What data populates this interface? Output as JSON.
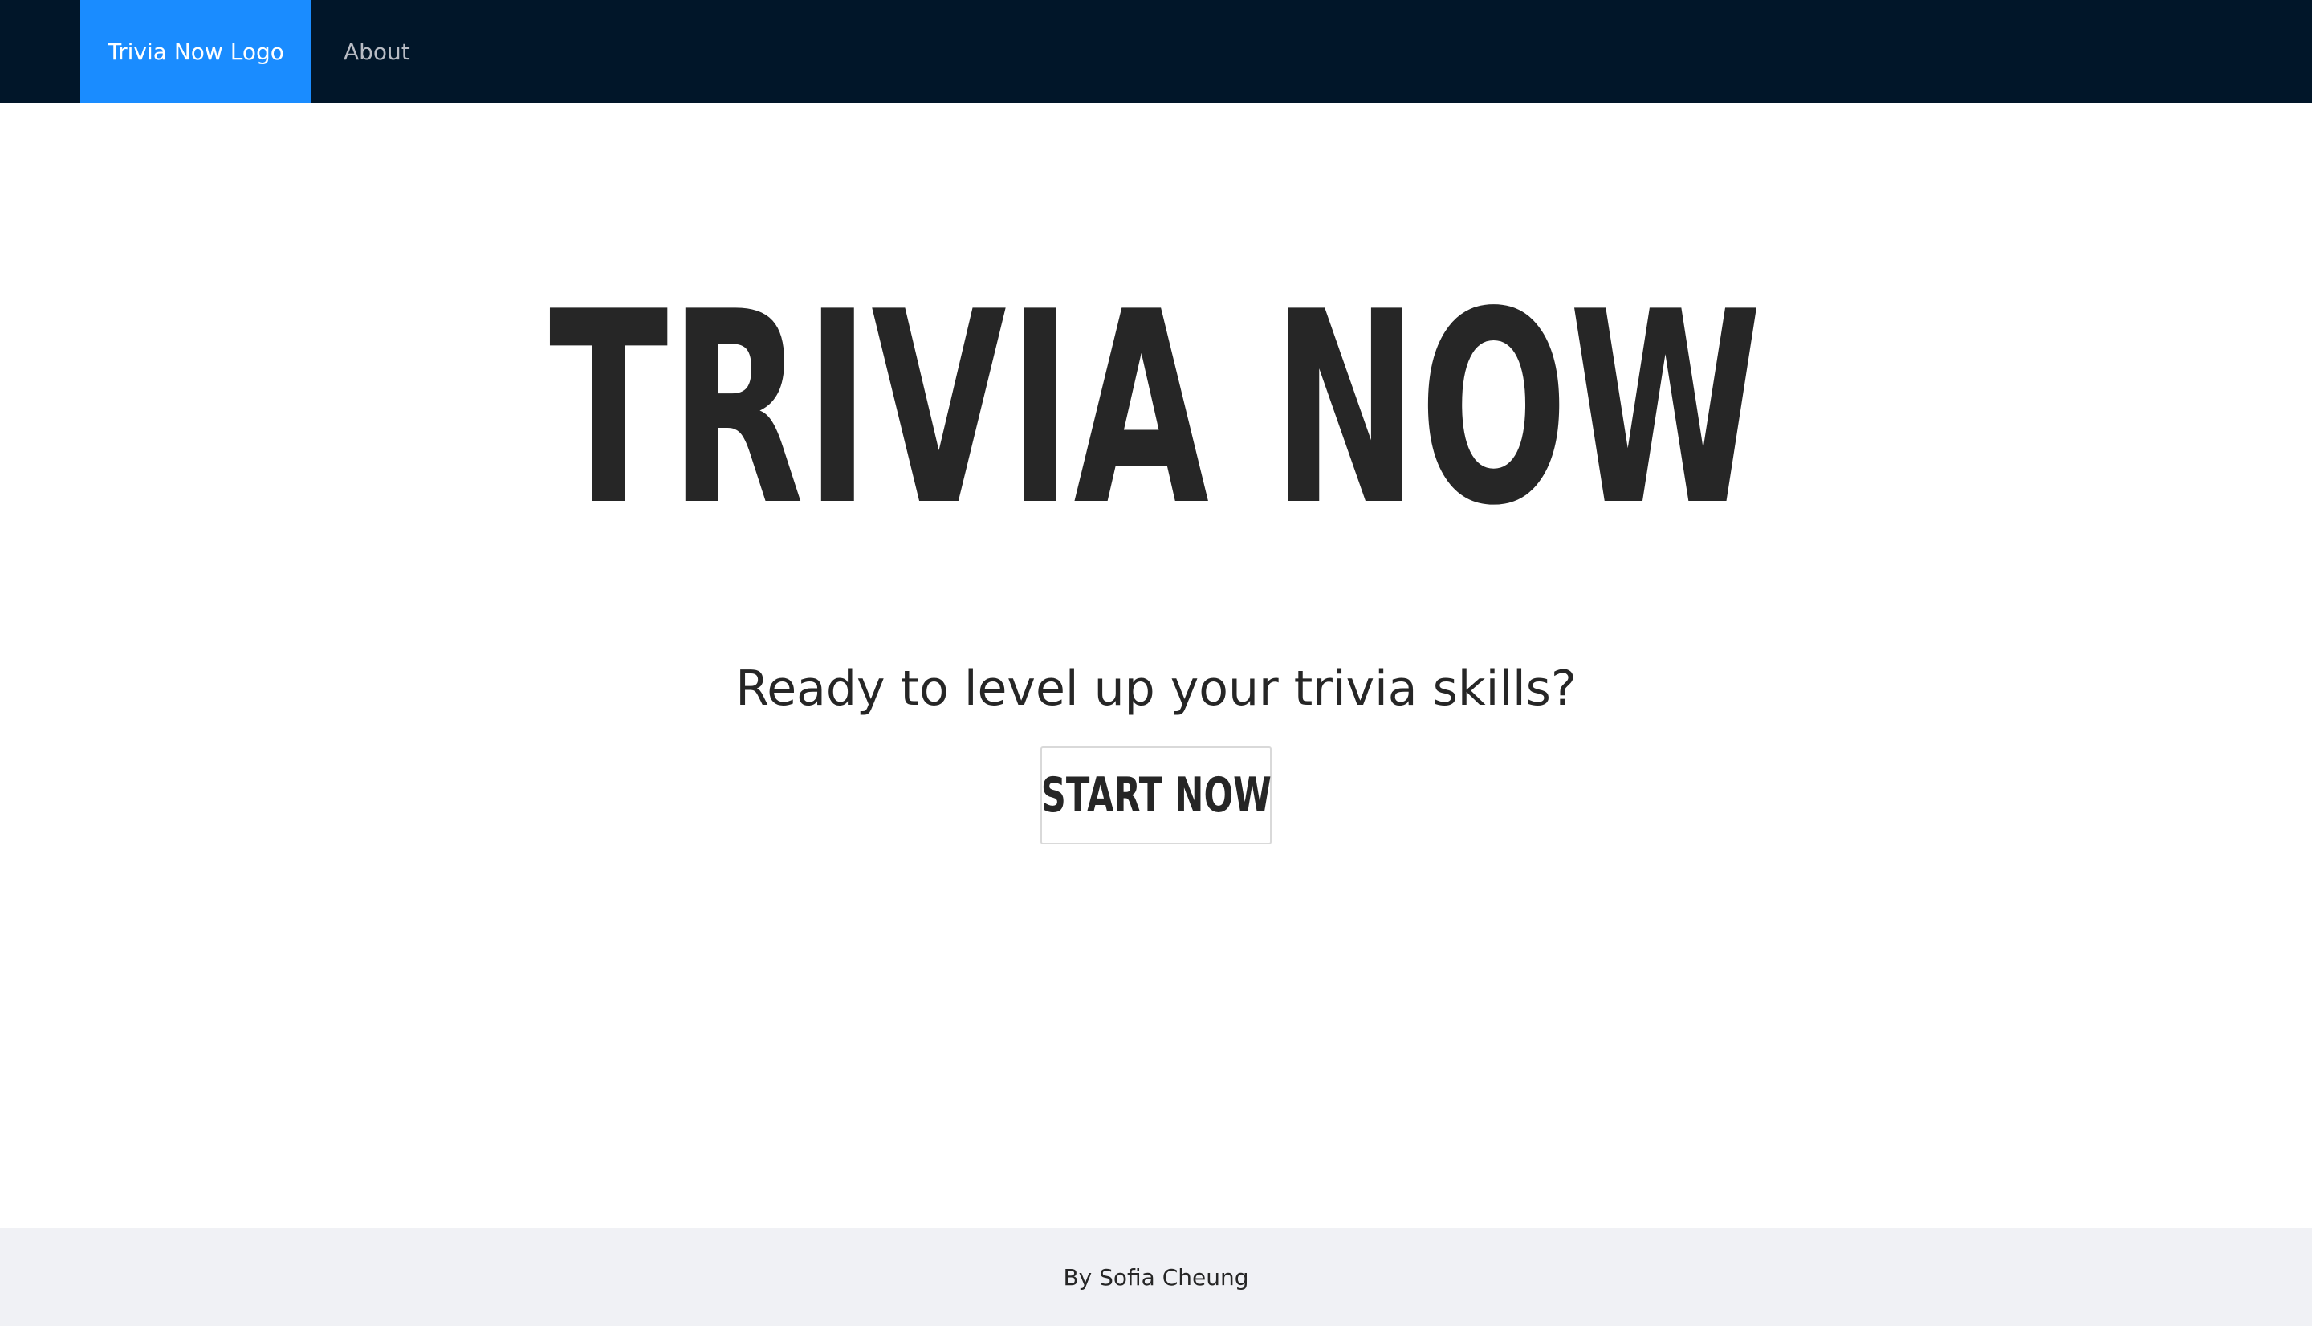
{
  "navbar": {
    "logo_label": "Trivia Now Logo",
    "about_label": "About",
    "background_color": "#011629",
    "logo_background_color": "#1a8cff"
  },
  "hero": {
    "title": "TRIVIA NOW",
    "subtitle": "Ready to level up your trivia skills?",
    "start_button_label": "START NOW"
  },
  "footer": {
    "credit": "By Sofia Cheung",
    "background_color": "#f0f1f5"
  }
}
